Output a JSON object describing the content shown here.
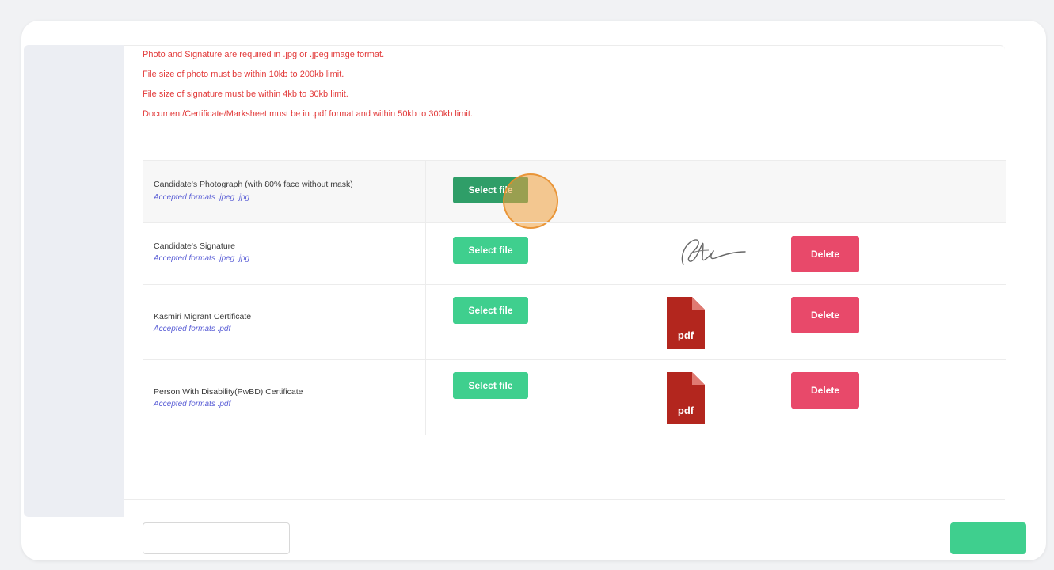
{
  "instructions": [
    "Photo and Signature are required in .jpg or .jpeg image format.",
    "File size of photo must be within 10kb to 200kb limit.",
    "File size of signature must be within 4kb to 30kb limit.",
    "Document/Certificate/Marksheet must be in .pdf format and within 50kb to 300kb limit."
  ],
  "uploads": [
    {
      "label": "Candidate's Photograph (with 80% face without mask)",
      "formats": "Accepted formats .jpeg .jpg",
      "select_label": "Select file"
    },
    {
      "label": "Candidate's Signature",
      "formats": "Accepted formats .jpeg .jpg",
      "select_label": "Select file",
      "preview": "signature-image",
      "delete_label": "Delete"
    },
    {
      "label": "Kasmiri Migrant Certificate",
      "formats": "Accepted formats .pdf",
      "select_label": "Select file",
      "preview_text": "pdf",
      "delete_label": "Delete"
    },
    {
      "label": "Person With Disability(PwBD) Certificate",
      "formats": "Accepted formats .pdf",
      "select_label": "Select file",
      "preview_text": "pdf",
      "delete_label": "Delete"
    }
  ],
  "colors": {
    "instruction_red": "#e23a3a",
    "select_green": "#3fcf8e",
    "delete_pink": "#e8496a",
    "pdf_red": "#b3261e",
    "format_blue": "#5b5fd6"
  },
  "icons": {
    "pdf": "pdf-file-icon",
    "signature": "signature-image",
    "cursor": "click-indicator"
  }
}
